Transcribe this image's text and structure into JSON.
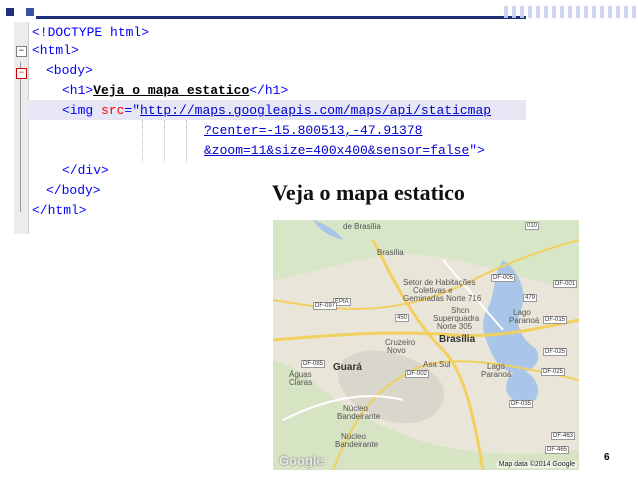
{
  "code": {
    "lines": [
      {
        "p1": "<!DOCTYPE html>"
      },
      {
        "p1": "<html>"
      },
      {
        "p1": "<body>"
      },
      {
        "p1": "<h1>",
        "p2": "Veja o mapa estatico",
        "p3": "</h1>"
      },
      {
        "p1": "<img ",
        "p2": "src",
        "p3": "=\"",
        "p4": "http://maps.googleapis.com/maps/api/staticmap"
      },
      {
        "p1": "?center",
        "p2": "=-15.800513,-47.91378"
      },
      {
        "p1": "&zoom=11&size=400x400&sensor=false",
        "p2": "\">"
      },
      {
        "p1": "</div>"
      },
      {
        "p1": "</body>"
      },
      {
        "p1": "</html>"
      }
    ]
  },
  "preview": {
    "heading": "Veja o mapa estatico"
  },
  "map": {
    "labels": [
      "Brasília",
      "Setor de Habitações",
      "Coletivas e",
      "Geminadas Norte 716",
      "Shcn",
      "Superquadra",
      "Norte 305",
      "Lago",
      "Paranoá",
      "Cruzeiro",
      "Novo",
      "Asa Sul",
      "Guará",
      "Águas",
      "Claras",
      "Núcleo",
      "Bandeirante",
      "Núcleo",
      "Bandeirante",
      "Lago",
      "Paranoá"
    ],
    "city_main": "Brasília",
    "city_guara": "Guará",
    "top_label": "de Brasília",
    "routes": [
      "DF-005",
      "DF-001",
      "479",
      "DF-015",
      "EPIA",
      "DF-097",
      "450",
      "DF-025",
      "DF-085",
      "DF-002",
      "DF-035",
      "DF-463",
      "DF-465",
      "010",
      "DF-025"
    ],
    "google_logo": "Google",
    "attribution": "Map data ©2014 Google"
  },
  "slide_number": "6",
  "colors": {
    "topbar_squares": [
      "#1f2f7a",
      "#ffffff",
      "#3a52a5",
      "#ffffff",
      "#8aa0d6"
    ]
  }
}
